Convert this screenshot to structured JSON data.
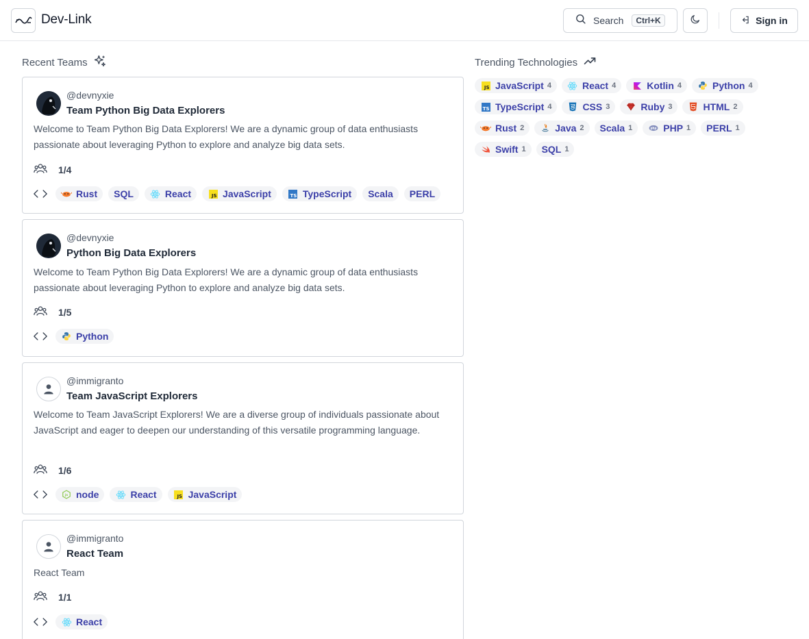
{
  "header": {
    "brand": "Dev-Link",
    "search_label": "Search",
    "search_shortcut": "Ctrl+K",
    "signin_label": "Sign in"
  },
  "recent": {
    "title": "Recent Teams",
    "cards": [
      {
        "handle": "@devnyxie",
        "name": "Team Python Big Data Explorers",
        "desc": "Welcome to Team Python Big Data Explorers! We are a dynamic group of data enthusiasts passionate about leveraging Python to explore and analyze big data sets.",
        "members": "1/4",
        "techs": [
          {
            "label": "Rust",
            "icon": "rust-icon"
          },
          {
            "label": "SQL",
            "icon": ""
          },
          {
            "label": "React",
            "icon": "react-icon"
          },
          {
            "label": "JavaScript",
            "icon": "javascript-icon"
          },
          {
            "label": "TypeScript",
            "icon": "typescript-icon"
          },
          {
            "label": "Scala",
            "icon": ""
          },
          {
            "label": "PERL",
            "icon": ""
          }
        ]
      },
      {
        "handle": "@devnyxie",
        "name": "Python Big Data Explorers",
        "desc": "Welcome to Team Python Big Data Explorers! We are a dynamic group of data enthusiasts passionate about leveraging Python to explore and analyze big data sets.",
        "members": "1/5",
        "techs": [
          {
            "label": "Python",
            "icon": "python-icon"
          }
        ]
      },
      {
        "handle": "@immigranto",
        "name": "Team JavaScript Explorers",
        "desc": "Welcome to Team JavaScript Explorers! We are a diverse group of individuals passionate about JavaScript and eager to deepen our understanding of this versatile programming language.",
        "members": "1/6",
        "techs": [
          {
            "label": "node",
            "icon": "node-icon"
          },
          {
            "label": "React",
            "icon": "react-icon"
          },
          {
            "label": "JavaScript",
            "icon": "javascript-icon"
          }
        ]
      },
      {
        "handle": "@immigranto",
        "name": "React Team",
        "desc": "React Team",
        "members": "1/1",
        "techs": [
          {
            "label": "React",
            "icon": "react-icon"
          }
        ]
      }
    ]
  },
  "trending": {
    "title": "Trending Technologies",
    "rows": [
      [
        {
          "label": "JavaScript",
          "count": "4",
          "icon": "javascript-icon"
        },
        {
          "label": "React",
          "count": "4",
          "icon": "react-icon"
        },
        {
          "label": "Kotlin",
          "count": "4",
          "icon": "kotlin-icon"
        },
        {
          "label": "Python",
          "count": "4",
          "icon": "python-icon"
        }
      ],
      [
        {
          "label": "TypeScript",
          "count": "4",
          "icon": "typescript-icon"
        },
        {
          "label": "CSS",
          "count": "3",
          "icon": "css-icon"
        },
        {
          "label": "Ruby",
          "count": "3",
          "icon": "ruby-icon"
        },
        {
          "label": "HTML",
          "count": "2",
          "icon": "html-icon"
        }
      ],
      [
        {
          "label": "Rust",
          "count": "2",
          "icon": "rust-icon"
        },
        {
          "label": "Java",
          "count": "2",
          "icon": "java-icon"
        },
        {
          "label": "Scala",
          "count": "1",
          "icon": ""
        },
        {
          "label": "PHP",
          "count": "1",
          "icon": "php-icon"
        },
        {
          "label": "PERL",
          "count": "1",
          "icon": ""
        }
      ],
      [
        {
          "label": "Swift",
          "count": "1",
          "icon": "swift-icon"
        },
        {
          "label": "SQL",
          "count": "1",
          "icon": ""
        }
      ]
    ]
  },
  "colors": {
    "chip_text": "#3b3fa8",
    "chip_bg": "#f3f4f6",
    "border": "#d1d5db"
  }
}
